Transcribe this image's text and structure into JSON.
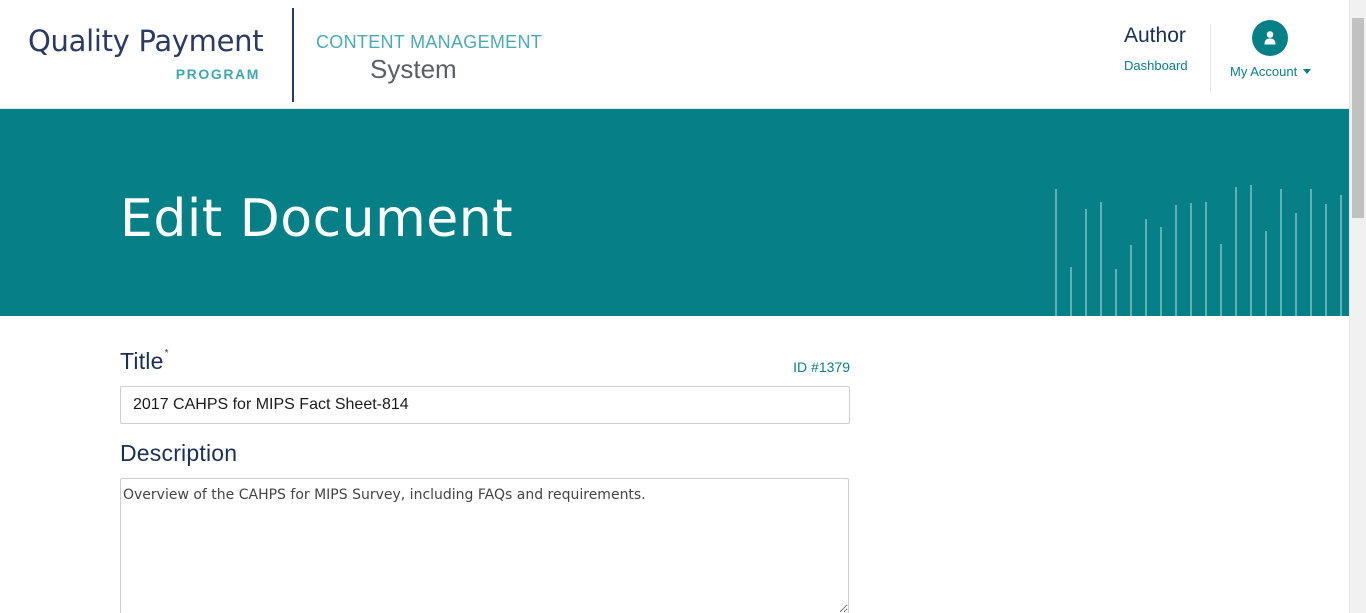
{
  "header": {
    "logo": {
      "line1": "Quality Payment",
      "line2": "PROGRAM"
    },
    "cms": {
      "top": "CONTENT MANAGEMENT",
      "bottom": "System"
    },
    "author": {
      "title": "Author",
      "link": "Dashboard"
    },
    "account": {
      "label": "My Account",
      "icon": "user-icon"
    }
  },
  "banner": {
    "title": "Edit Document"
  },
  "form": {
    "title_label": "Title",
    "required_mark": "*",
    "id_text": "ID #1379",
    "title_value": "2017 CAHPS for MIPS Fact Sheet-814",
    "description_label": "Description",
    "description_value": "Overview of the CAHPS for MIPS Survey, including FAQs and requirements."
  },
  "colors": {
    "brand_teal": "#068086",
    "navy": "#1b2f55",
    "link_teal": "#0c7f85"
  }
}
